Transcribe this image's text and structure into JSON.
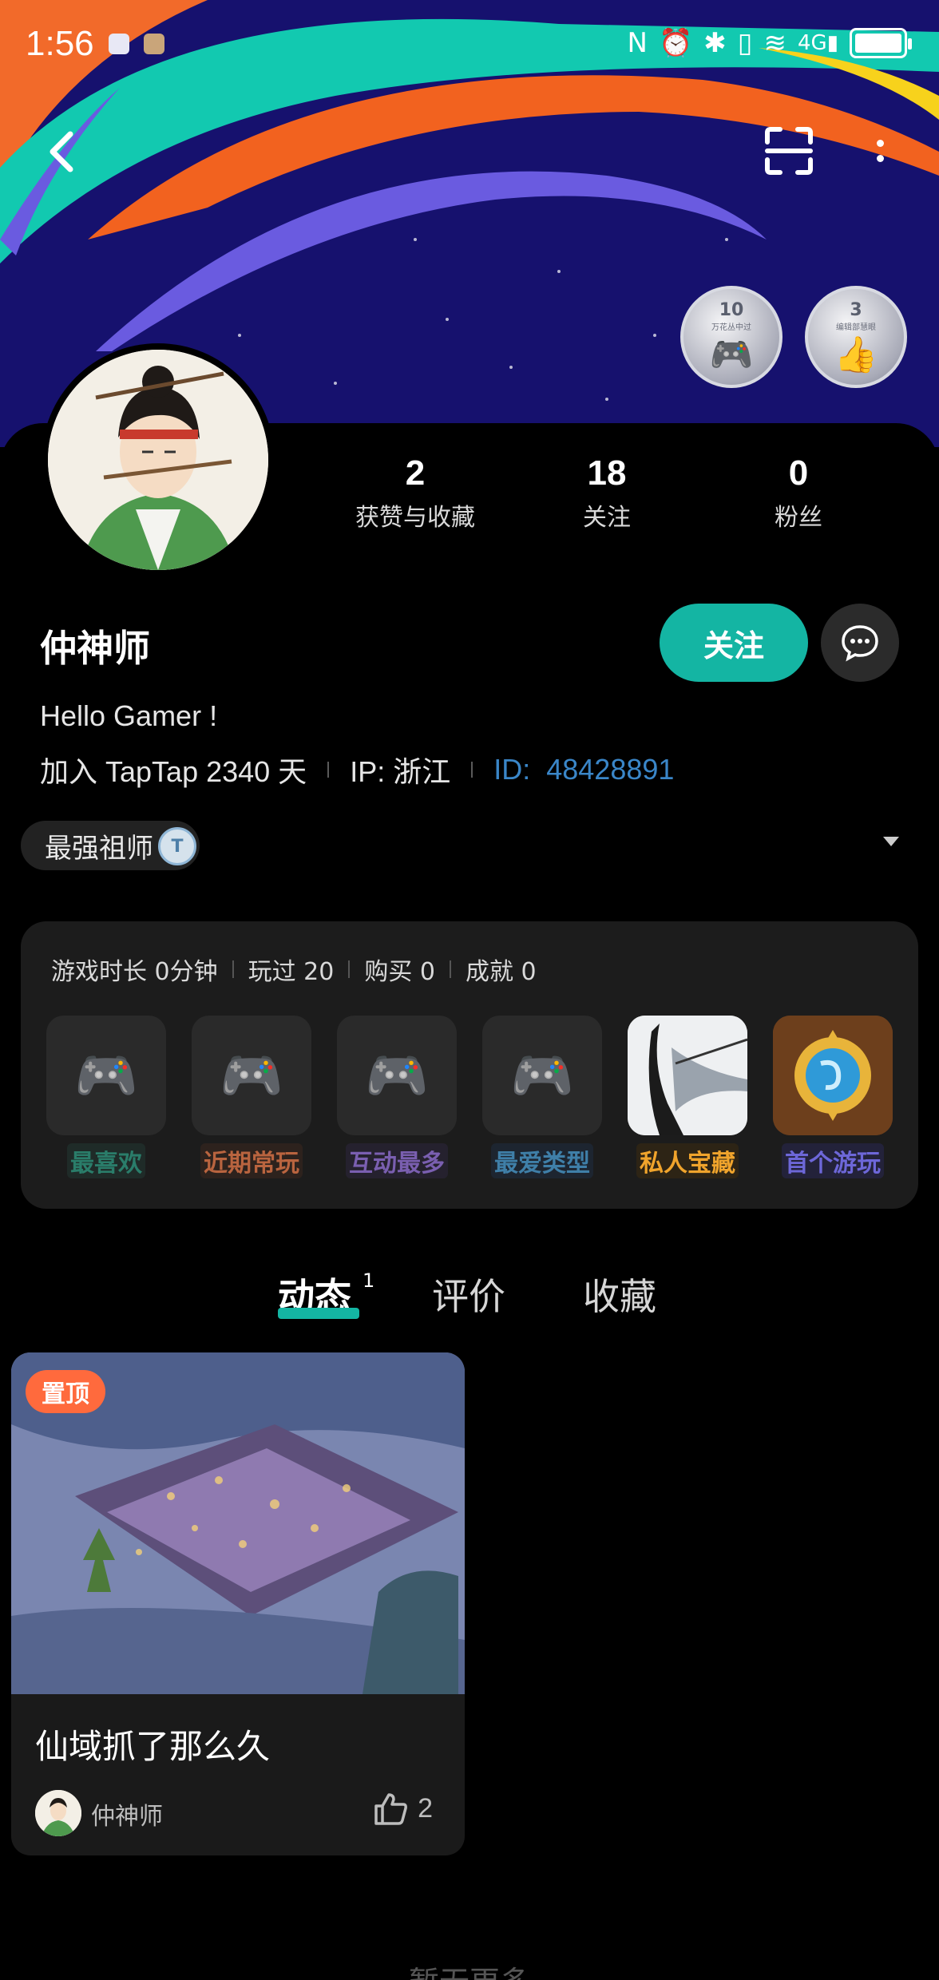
{
  "status_bar": {
    "time": "1:56"
  },
  "header": {
    "back_icon": "back-arrow-icon",
    "scan_icon": "scan-icon",
    "more_icon": "more-vertical-icon",
    "badges": [
      {
        "num": "10",
        "sub": "万花丛中过"
      },
      {
        "num": "3",
        "sub": "编辑部慧眼"
      }
    ]
  },
  "profile": {
    "stats": [
      {
        "value": "2",
        "label": "获赞与收藏"
      },
      {
        "value": "18",
        "label": "关注"
      },
      {
        "value": "0",
        "label": "粉丝"
      }
    ],
    "username": "仲神师",
    "follow_label": "关注",
    "bio": "Hello Gamer !",
    "joined": "加入 TapTap 2340 天",
    "ip": "IP:  浙江",
    "id_label": "ID:",
    "id_value": "48428891",
    "title_chip": "最强祖师"
  },
  "game_panel": {
    "stats": [
      "游戏时长 0分钟",
      "玩过 20",
      "购买 0",
      "成就 0"
    ],
    "tiles": [
      {
        "label": "最喜欢",
        "color": "#2a7d6a",
        "bg": "#1f2b28"
      },
      {
        "label": "近期常玩",
        "color": "#b9643f",
        "bg": "#2d221d"
      },
      {
        "label": "互动最多",
        "color": "#7a5fb0",
        "bg": "#25212e"
      },
      {
        "label": "最爱类型",
        "color": "#3f7fa8",
        "bg": "#1d2530"
      },
      {
        "label": "私人宝藏",
        "color": "#f0a42c",
        "bg": "#2d2415"
      },
      {
        "label": "首个游玩",
        "color": "#6d67d8",
        "bg": "#23223a"
      }
    ]
  },
  "tabs": {
    "items": [
      "动态",
      "评价",
      "收藏"
    ],
    "active": "动态",
    "badge": "1"
  },
  "post": {
    "pin_label": "置顶",
    "title": "仙域抓了那么久",
    "author": "仲神师",
    "likes": "2"
  },
  "footer": {
    "text": "暂无更多"
  },
  "colors": {
    "accent": "#14b5a3",
    "id_blue": "#3a86c8",
    "pin": "#ff6a3d"
  }
}
